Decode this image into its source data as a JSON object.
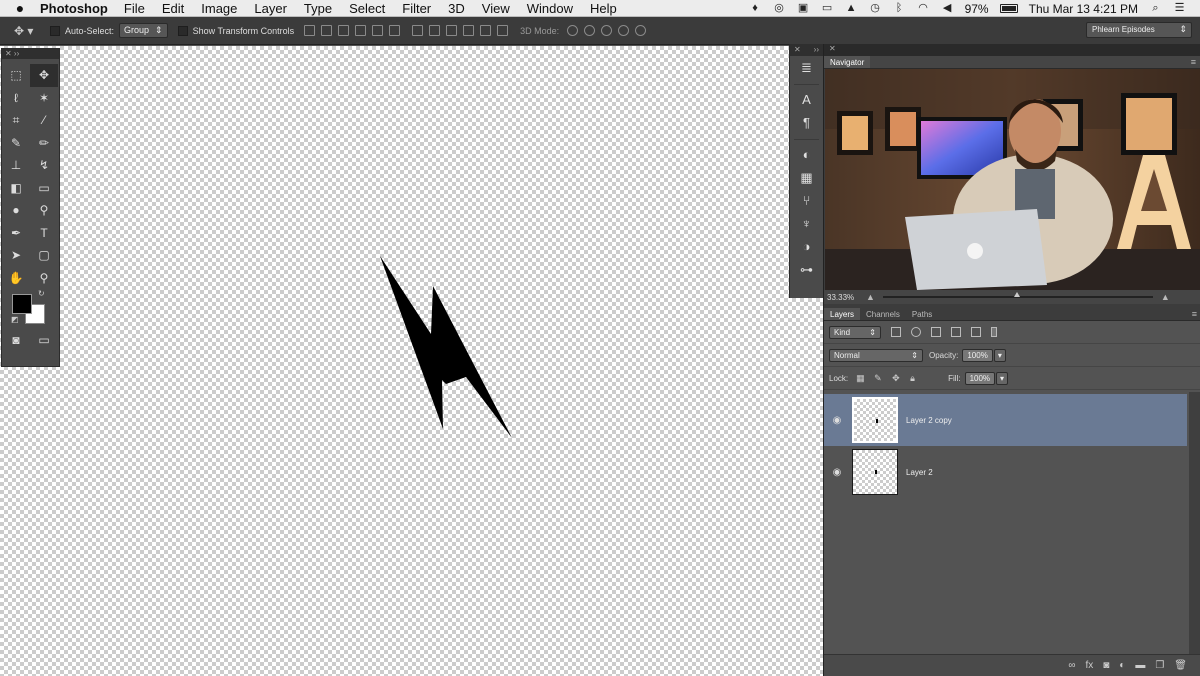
{
  "menubar": {
    "app_name": "Photoshop",
    "menus": [
      "File",
      "Edit",
      "Image",
      "Layer",
      "Type",
      "Select",
      "Filter",
      "3D",
      "View",
      "Window",
      "Help"
    ],
    "battery": "97%",
    "clock": "Thu Mar 13  4:21 PM"
  },
  "options_bar": {
    "auto_select_label": "Auto-Select:",
    "auto_select_value": "Group",
    "show_transform_label": "Show Transform Controls",
    "mode_3d_label": "3D Mode:",
    "workspace": "Phlearn Episodes"
  },
  "navigator": {
    "tab": "Navigator",
    "zoom": "33.33%"
  },
  "layers_panel": {
    "tabs": [
      "Layers",
      "Channels",
      "Paths"
    ],
    "filter_kind": "Kind",
    "blend_mode": "Normal",
    "opacity_label": "Opacity:",
    "opacity_value": "100%",
    "lock_label": "Lock:",
    "fill_label": "Fill:",
    "fill_value": "100%",
    "layers": [
      {
        "name": "Layer 2 copy",
        "selected": true,
        "visible": true
      },
      {
        "name": "Layer 2",
        "selected": false,
        "visible": true
      }
    ]
  },
  "colors": {
    "foreground": "#000000",
    "background": "#ffffff",
    "selected_layer": "#6a7a94"
  }
}
